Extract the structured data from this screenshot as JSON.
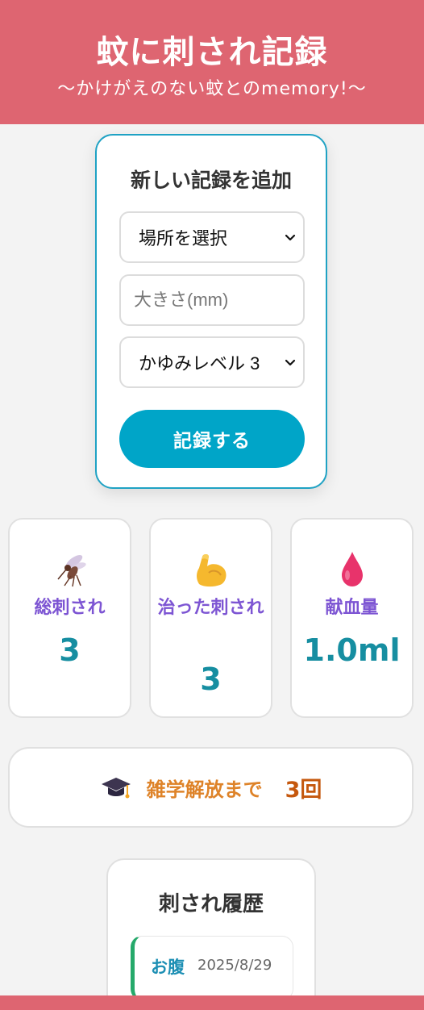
{
  "header": {
    "title": "蚊に刺され記録",
    "subtitle": "〜かけがえのない蚊とのmemory!〜"
  },
  "form": {
    "title": "新しい記録を追加",
    "location_select": "場所を選択",
    "size_placeholder": "大きさ(mm)",
    "itch_select": "かゆみレベル 3",
    "submit_label": "記録する"
  },
  "stats": [
    {
      "icon": "mosquito-icon",
      "label": "総刺され",
      "value": "3"
    },
    {
      "icon": "flexed-biceps-icon",
      "label": "治った刺され",
      "value": "3"
    },
    {
      "icon": "blood-drop-icon",
      "label": "献血量",
      "value": "1.0ml"
    }
  ],
  "trivia": {
    "icon": "graduation-cap-icon",
    "label": "雑学解放まで",
    "value": "3回"
  },
  "history": {
    "title": "刺され履歴",
    "entries": [
      {
        "place": "お腹",
        "date": "2025/8/29"
      }
    ]
  },
  "colors": {
    "header": "#de6571",
    "accent": "#00a5c8",
    "stat_label": "#7d55d3",
    "stat_value": "#168ea1",
    "trivia": "#de8329"
  }
}
